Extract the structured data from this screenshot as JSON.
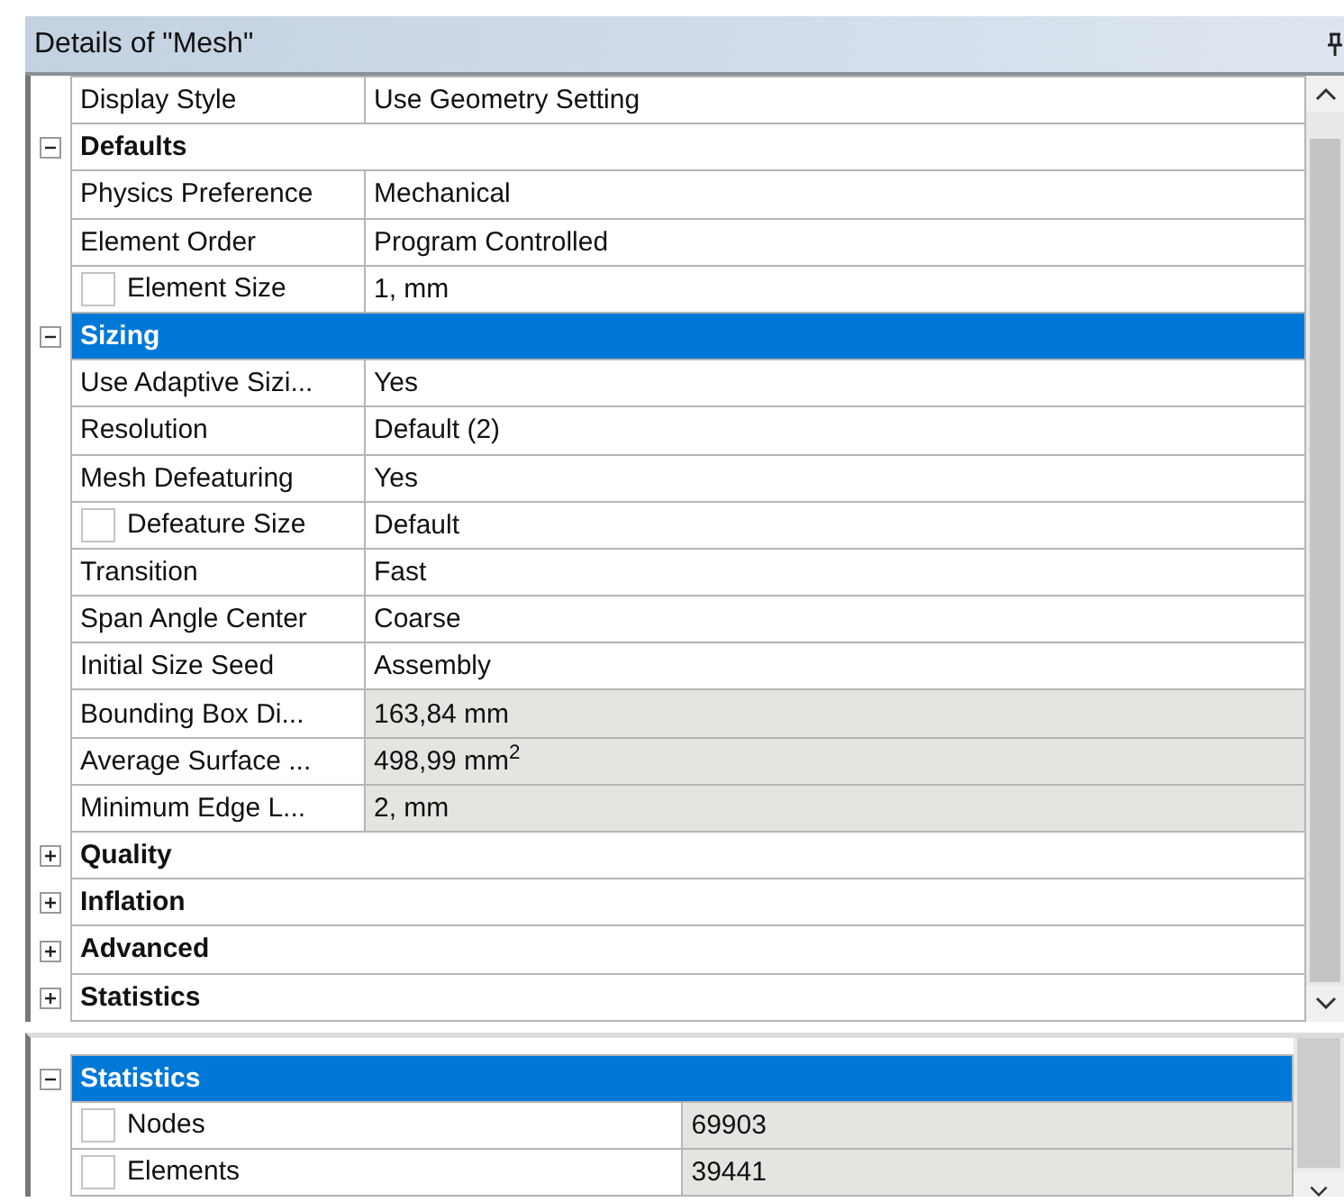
{
  "title": "Details of \"Mesh\"",
  "rows": [
    {
      "kind": "property",
      "label": "Display Style",
      "value": "Use Geometry Setting",
      "readonly": false
    },
    {
      "kind": "group",
      "label": "Defaults",
      "expanded": true,
      "selected": false
    },
    {
      "kind": "property",
      "label": "Physics Preference",
      "value": "Mechanical",
      "readonly": false
    },
    {
      "kind": "property",
      "label": "Element Order",
      "value": "Program Controlled",
      "readonly": false
    },
    {
      "kind": "property",
      "label": "Element Size",
      "value": "1, mm",
      "readonly": false,
      "checked": false
    },
    {
      "kind": "group",
      "label": "Sizing",
      "expanded": true,
      "selected": true
    },
    {
      "kind": "property",
      "label": "Use Adaptive Sizi...",
      "value": "Yes",
      "readonly": false
    },
    {
      "kind": "property",
      "label": "Resolution",
      "value": "Default (2)",
      "readonly": false
    },
    {
      "kind": "property",
      "label": "Mesh Defeaturing",
      "value": "Yes",
      "readonly": false
    },
    {
      "kind": "property",
      "label": "Defeature Size",
      "value": "Default",
      "readonly": false,
      "checked": false
    },
    {
      "kind": "property",
      "label": "Transition",
      "value": "Fast",
      "readonly": false
    },
    {
      "kind": "property",
      "label": "Span Angle Center",
      "value": "Coarse",
      "readonly": false
    },
    {
      "kind": "property",
      "label": "Initial Size Seed",
      "value": "Assembly",
      "readonly": false
    },
    {
      "kind": "property",
      "label": "Bounding Box Di...",
      "value": "163,84 mm",
      "readonly": true
    },
    {
      "kind": "property",
      "label": "Average Surface ...",
      "value": "498,99 mm$^{2}$",
      "readonly": true
    },
    {
      "kind": "property",
      "label": "Minimum Edge L...",
      "value": "2, mm",
      "readonly": true
    },
    {
      "kind": "group",
      "label": "Quality",
      "expanded": false,
      "selected": false
    },
    {
      "kind": "group",
      "label": "Inflation",
      "expanded": false,
      "selected": false
    },
    {
      "kind": "group",
      "label": "Advanced",
      "expanded": false,
      "selected": false
    },
    {
      "kind": "group",
      "label": "Statistics",
      "expanded": false,
      "selected": false
    }
  ],
  "lower_rows": [
    {
      "kind": "group",
      "label": "Statistics",
      "expanded": true,
      "selected": true
    },
    {
      "kind": "property",
      "label": "Nodes",
      "value": "69903",
      "readonly": true,
      "checked": false
    },
    {
      "kind": "property",
      "label": "Elements",
      "value": "39441",
      "readonly": true,
      "checked": false
    }
  ]
}
